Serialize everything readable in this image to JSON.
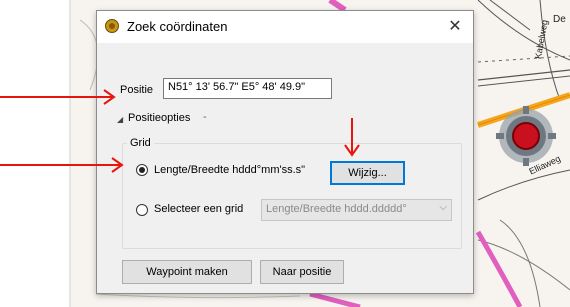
{
  "map": {
    "labels": [
      "De",
      "Kabelweg",
      "Elliaweg"
    ]
  },
  "dialog": {
    "title": "Zoek coördinaten",
    "close_icon": "close-icon",
    "position_label": "Positie",
    "position_value": "N51° 13' 56.7\" E5° 48' 49.9\"",
    "options_expander": "Positieopties",
    "options_dash": "-",
    "grid_group_label": "Grid",
    "radio_latlon_label": "Lengte/Breedte hddd°mm'ss.s\"",
    "radio_latlon_checked": true,
    "change_button": "Wijzig...",
    "radio_grid_label": "Selecteer een grid",
    "radio_grid_checked": false,
    "grid_select_value": "Lengte/Breedte hddd.ddddd°",
    "waypoint_button": "Waypoint maken",
    "goto_button": "Naar positie"
  },
  "colors": {
    "arrow": "#e8150f",
    "focus_border": "#0078d7",
    "map_road_pink": "#e05fbf",
    "map_road_orange": "#f6a61c",
    "marker_red": "#c8101e"
  }
}
